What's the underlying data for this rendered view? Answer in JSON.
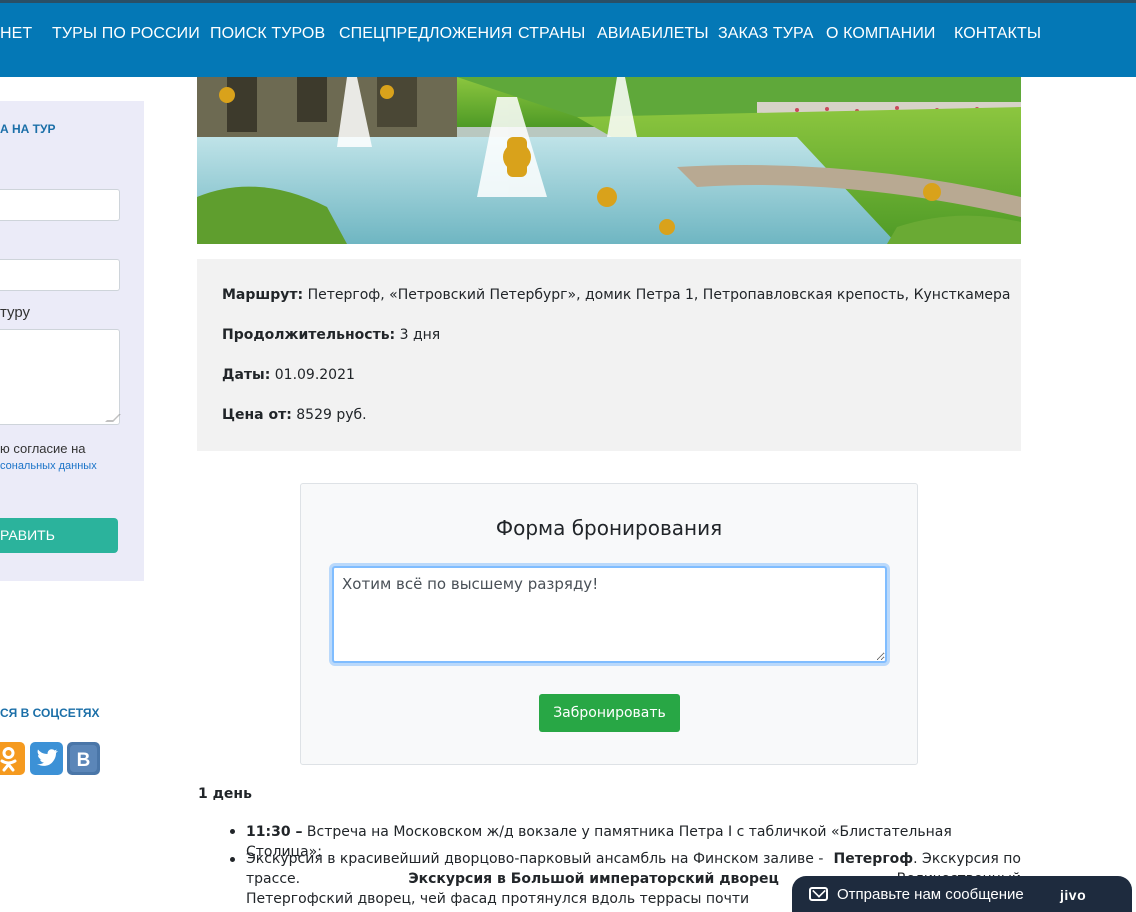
{
  "nav": {
    "items": [
      "НЕТ",
      "ТУРЫ ПО РОССИИ",
      "ПОИСК ТУРОВ",
      "СПЕЦПРЕДЛОЖЕНИЯ",
      "СТРАНЫ",
      "АВИАБИЛЕТЫ",
      "ЗАКАЗ ТУРА",
      "О КОМПАНИИ",
      "КОНТАКТЫ"
    ]
  },
  "sidebar": {
    "title": "А НА ТУР",
    "comment_label": "туру",
    "consent_text": "ю согласие на",
    "consent_link": "сональных данных",
    "submit_label": "РАВИТЬ",
    "social_title": "СЯ В СОЦСЕТЯХ",
    "social_icons": [
      "odnoklassniki-icon",
      "twitter-icon",
      "vk-icon"
    ]
  },
  "tour": {
    "route_label": "Маршрут:",
    "route_value": "Петергоф, «Петровский Петербург», домик Петра 1, Петропавловская крепость, Кунсткамера",
    "duration_label": "Продолжительность:",
    "duration_value": "3 дня",
    "dates_label": "Даты:",
    "dates_value": "01.09.2021",
    "price_label": "Цена от:",
    "price_value": "8529 руб."
  },
  "booking": {
    "title": "Форма бронирования",
    "message_value": "Хотим всё по высшему разряду!",
    "submit_label": "Забронировать"
  },
  "program": {
    "day_title": "1 день",
    "item1_time": "11:30 –",
    "item1_text": " Встреча на Московском ж/д вокзале у памятника Петра I с табличкой «Блистательная Столица»;",
    "item2_line1_a": "Экскурсия в красивейший дворцово-парковый ансамбль на Финском заливе -",
    "item2_line1_b": "Петергоф",
    "item2_line1_c": ". Экскурсия по",
    "item2_line2_a": "трассе.",
    "item2_line2_b": "Экскурсия в Большой императорский дворец",
    "item2_line2_c": "- Величественный",
    "item2_line3": "Петергофский дворец, чей фасад протянулся вдоль террасы почти"
  },
  "chat": {
    "label": "Отправьте нам сообщение",
    "brand": "jivo"
  },
  "colors": {
    "nav_bg": "#0478b6",
    "sidebar_bg": "#ebebf8",
    "sidebar_button": "#2bb39c",
    "book_button": "#28a745",
    "chat_bg": "#1e2b3e"
  }
}
